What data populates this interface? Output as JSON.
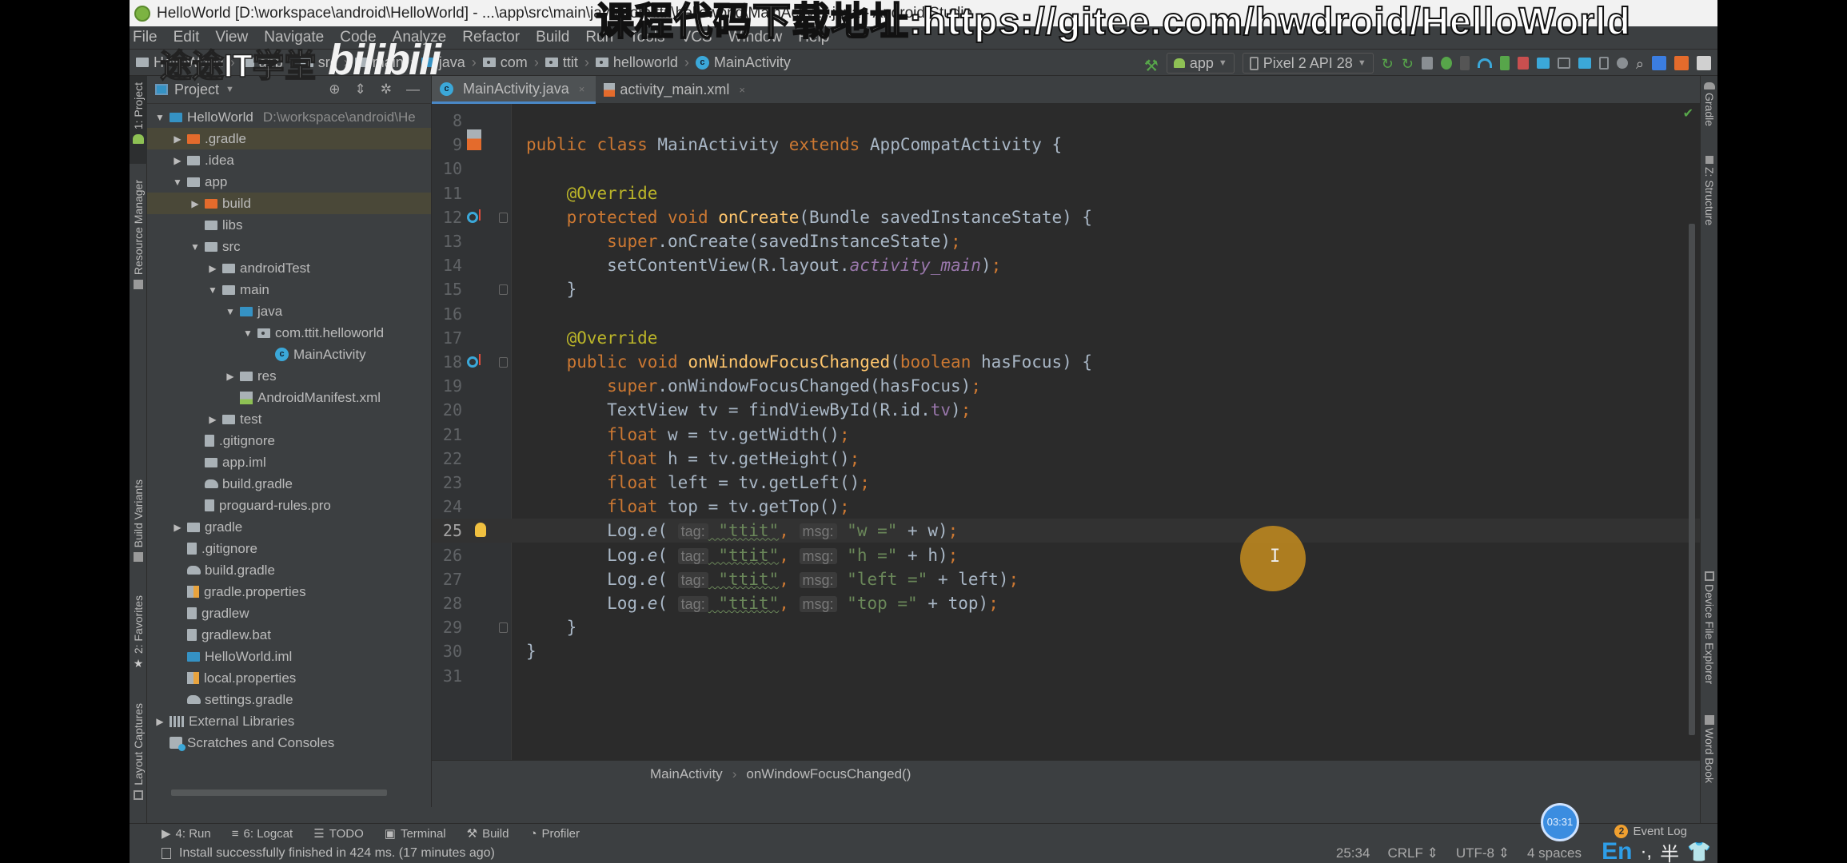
{
  "window": {
    "title": "HelloWorld [D:\\workspace\\android\\HelloWorld] - ...\\app\\src\\main\\java\\com\\ttit\\helloworld\\MainActivity.java - Android Studio"
  },
  "overlays": {
    "watermark_top": "课程代码下载地址:https://gitee.com/hwdroid/HelloWorld",
    "watermark_channel": "途途IT学堂",
    "watermark_site": "bilibili"
  },
  "menu": [
    "File",
    "Edit",
    "View",
    "Navigate",
    "Code",
    "Analyze",
    "Refactor",
    "Build",
    "Run",
    "Tools",
    "VCS",
    "Window",
    "Help"
  ],
  "navbar": {
    "crumbs": [
      {
        "label": "HelloWorld",
        "icon": "project-folder-icon"
      },
      {
        "label": "app",
        "icon": "module-folder-icon"
      },
      {
        "label": "src",
        "icon": "folder-icon"
      },
      {
        "label": "main",
        "icon": "folder-icon"
      },
      {
        "label": "java",
        "icon": "source-folder-icon"
      },
      {
        "label": "com",
        "icon": "package-icon"
      },
      {
        "label": "ttit",
        "icon": "package-icon"
      },
      {
        "label": "helloworld",
        "icon": "package-icon"
      },
      {
        "label": "MainActivity",
        "icon": "class-icon"
      }
    ],
    "run_config": "app",
    "device": "Pixel 2 API 28",
    "toolbar_icons": [
      "hammer-icon",
      "apply-changes-icon",
      "apply-code-changes-icon",
      "coverage-icon",
      "debug-icon",
      "attach-icon",
      "profile-icon",
      "debug-attach-icon",
      "stop-icon",
      "sync-icon",
      "avd-manager-icon",
      "sdk-manager-icon",
      "device-manager-icon",
      "layout-inspector-icon",
      "search-icon",
      "translate-icon",
      "plugin-icon",
      "account-icon"
    ]
  },
  "left_strip": {
    "tabs": [
      "1: Project",
      "Resource Manager",
      "Build Variants",
      "2: Favorites",
      "Layout Captures"
    ]
  },
  "right_strip": {
    "tabs": [
      "Gradle",
      "Z: Structure",
      "Device File Explorer",
      "Word Book"
    ]
  },
  "project_panel": {
    "title": "Project",
    "tree": [
      {
        "label": "HelloWorld",
        "path": "D:\\workspace\\android\\He",
        "depth": 0,
        "toggle": "open",
        "icon": "project"
      },
      {
        "label": ".gradle",
        "depth": 1,
        "toggle": "closed",
        "icon": "orange-folder",
        "highlight": true
      },
      {
        "label": ".idea",
        "depth": 1,
        "toggle": "closed",
        "icon": "folder"
      },
      {
        "label": "app",
        "depth": 1,
        "toggle": "open",
        "icon": "module"
      },
      {
        "label": "build",
        "depth": 2,
        "toggle": "closed",
        "icon": "orange-folder",
        "highlight": true
      },
      {
        "label": "libs",
        "depth": 2,
        "toggle": "none",
        "icon": "folder"
      },
      {
        "label": "src",
        "depth": 2,
        "toggle": "open",
        "icon": "folder"
      },
      {
        "label": "androidTest",
        "depth": 3,
        "toggle": "closed",
        "icon": "folder"
      },
      {
        "label": "main",
        "depth": 3,
        "toggle": "open",
        "icon": "folder"
      },
      {
        "label": "java",
        "depth": 4,
        "toggle": "open",
        "icon": "blue-folder"
      },
      {
        "label": "com.ttit.helloworld",
        "depth": 5,
        "toggle": "open",
        "icon": "package"
      },
      {
        "label": "MainActivity",
        "depth": 6,
        "toggle": "none",
        "icon": "class"
      },
      {
        "label": "res",
        "depth": 4,
        "toggle": "closed",
        "icon": "res-folder"
      },
      {
        "label": "AndroidManifest.xml",
        "depth": 4,
        "toggle": "none",
        "icon": "manifest"
      },
      {
        "label": "test",
        "depth": 3,
        "toggle": "closed",
        "icon": "folder"
      },
      {
        "label": ".gitignore",
        "depth": 2,
        "toggle": "none",
        "icon": "file"
      },
      {
        "label": "app.iml",
        "depth": 2,
        "toggle": "none",
        "icon": "module"
      },
      {
        "label": "build.gradle",
        "depth": 2,
        "toggle": "none",
        "icon": "gradle"
      },
      {
        "label": "proguard-rules.pro",
        "depth": 2,
        "toggle": "none",
        "icon": "file"
      },
      {
        "label": "gradle",
        "depth": 1,
        "toggle": "closed",
        "icon": "folder"
      },
      {
        "label": ".gitignore",
        "depth": 1,
        "toggle": "none",
        "icon": "file"
      },
      {
        "label": "build.gradle",
        "depth": 1,
        "toggle": "none",
        "icon": "gradle"
      },
      {
        "label": "gradle.properties",
        "depth": 1,
        "toggle": "none",
        "icon": "props"
      },
      {
        "label": "gradlew",
        "depth": 1,
        "toggle": "none",
        "icon": "file"
      },
      {
        "label": "gradlew.bat",
        "depth": 1,
        "toggle": "none",
        "icon": "file"
      },
      {
        "label": "HelloWorld.iml",
        "depth": 1,
        "toggle": "none",
        "icon": "project"
      },
      {
        "label": "local.properties",
        "depth": 1,
        "toggle": "none",
        "icon": "props"
      },
      {
        "label": "settings.gradle",
        "depth": 1,
        "toggle": "none",
        "icon": "gradle"
      },
      {
        "label": "External Libraries",
        "depth": 0,
        "toggle": "closed",
        "icon": "libs"
      },
      {
        "label": "Scratches and Consoles",
        "depth": 0,
        "toggle": "none",
        "icon": "scratch"
      }
    ]
  },
  "editor": {
    "tabs": [
      {
        "label": "MainActivity.java",
        "active": true,
        "icon": "class-icon"
      },
      {
        "label": "activity_main.xml",
        "active": false,
        "icon": "xml-icon"
      }
    ],
    "current_line": 25,
    "lines": [
      {
        "n": "8",
        "tokens": []
      },
      {
        "n": "9",
        "gutter": "xml",
        "tokens": [
          [
            "kw",
            "public "
          ],
          [
            "kw",
            "class "
          ],
          [
            "",
            "MainActivity "
          ],
          [
            "kw",
            "extends "
          ],
          [
            "",
            "AppCompatActivity {"
          ]
        ]
      },
      {
        "n": "10",
        "tokens": []
      },
      {
        "n": "11",
        "tokens": [
          [
            "",
            "    "
          ],
          [
            "ann",
            "@Override"
          ]
        ]
      },
      {
        "n": "12",
        "gutter": "override",
        "fold": true,
        "tokens": [
          [
            "",
            "    "
          ],
          [
            "kw",
            "protected "
          ],
          [
            "kw",
            "void "
          ],
          [
            "fn",
            "onCreate"
          ],
          [
            "",
            "(Bundle savedInstanceState) {"
          ]
        ]
      },
      {
        "n": "13",
        "tokens": [
          [
            "",
            "        "
          ],
          [
            "kw",
            "super"
          ],
          [
            "",
            ".onCreate(savedInstanceState)"
          ],
          [
            "punct",
            ";"
          ]
        ]
      },
      {
        "n": "14",
        "tokens": [
          [
            "",
            "        setContentView(R.layout."
          ],
          [
            "fld",
            "activity_main"
          ],
          [
            "",
            ")"
          ],
          [
            "punct",
            ";"
          ]
        ]
      },
      {
        "n": "15",
        "fold": true,
        "tokens": [
          [
            "",
            "    }"
          ]
        ]
      },
      {
        "n": "16",
        "tokens": []
      },
      {
        "n": "17",
        "tokens": [
          [
            "",
            "    "
          ],
          [
            "ann",
            "@Override"
          ]
        ]
      },
      {
        "n": "18",
        "gutter": "override",
        "fold": true,
        "tokens": [
          [
            "",
            "    "
          ],
          [
            "kw",
            "public "
          ],
          [
            "kw",
            "void "
          ],
          [
            "fn",
            "onWindowFocusChanged"
          ],
          [
            "",
            "("
          ],
          [
            "kw",
            "boolean "
          ],
          [
            "",
            "hasFocus) {"
          ]
        ]
      },
      {
        "n": "19",
        "tokens": [
          [
            "",
            "        "
          ],
          [
            "kw",
            "super"
          ],
          [
            "",
            ".onWindowFocusChanged(hasFocus)"
          ],
          [
            "punct",
            ";"
          ]
        ]
      },
      {
        "n": "20",
        "tokens": [
          [
            "",
            "        TextView tv = findViewById(R.id."
          ],
          [
            "fld2",
            "tv"
          ],
          [
            "",
            ")"
          ],
          [
            "punct",
            ";"
          ]
        ]
      },
      {
        "n": "21",
        "tokens": [
          [
            "",
            "        "
          ],
          [
            "kw",
            "float "
          ],
          [
            "",
            "w = tv.getWidth()"
          ],
          [
            "punct",
            ";"
          ]
        ]
      },
      {
        "n": "22",
        "tokens": [
          [
            "",
            "        "
          ],
          [
            "kw",
            "float "
          ],
          [
            "",
            "h = tv.getHeight()"
          ],
          [
            "punct",
            ";"
          ]
        ]
      },
      {
        "n": "23",
        "tokens": [
          [
            "",
            "        "
          ],
          [
            "kw",
            "float "
          ],
          [
            "",
            "left = tv.getLeft()"
          ],
          [
            "punct",
            ";"
          ]
        ]
      },
      {
        "n": "24",
        "tokens": [
          [
            "",
            "        "
          ],
          [
            "kw",
            "float "
          ],
          [
            "",
            "top = tv.getTop()"
          ],
          [
            "punct",
            ";"
          ]
        ]
      },
      {
        "n": "25",
        "gutter": "bulb",
        "tokens": [
          [
            "",
            "        Log."
          ],
          [
            "fnit",
            "e"
          ],
          [
            "",
            "( "
          ],
          [
            "hint",
            "tag:"
          ],
          [
            "str",
            " \"ttit\""
          ],
          [
            "punct",
            ", "
          ],
          [
            "hint",
            "msg:"
          ],
          [
            "str",
            " \"w =\""
          ],
          [
            "",
            " + w)"
          ],
          [
            "punct",
            ";"
          ]
        ]
      },
      {
        "n": "26",
        "tokens": [
          [
            "",
            "        Log."
          ],
          [
            "fnit",
            "e"
          ],
          [
            "",
            "( "
          ],
          [
            "hint",
            "tag:"
          ],
          [
            "str",
            " \"ttit\""
          ],
          [
            "punct",
            ", "
          ],
          [
            "hint",
            "msg:"
          ],
          [
            "str",
            " \"h =\""
          ],
          [
            "",
            " + h)"
          ],
          [
            "punct",
            ";"
          ]
        ]
      },
      {
        "n": "27",
        "tokens": [
          [
            "",
            "        Log."
          ],
          [
            "fnit",
            "e"
          ],
          [
            "",
            "( "
          ],
          [
            "hint",
            "tag:"
          ],
          [
            "str",
            " \"ttit\""
          ],
          [
            "punct",
            ", "
          ],
          [
            "hint",
            "msg:"
          ],
          [
            "str",
            " \"left =\""
          ],
          [
            "",
            " + left)"
          ],
          [
            "punct",
            ";"
          ]
        ]
      },
      {
        "n": "28",
        "tokens": [
          [
            "",
            "        Log."
          ],
          [
            "fnit",
            "e"
          ],
          [
            "",
            "( "
          ],
          [
            "hint",
            "tag:"
          ],
          [
            "str",
            " \"ttit\""
          ],
          [
            "punct",
            ", "
          ],
          [
            "hint",
            "msg:"
          ],
          [
            "str",
            " \"top =\""
          ],
          [
            "",
            " + top)"
          ],
          [
            "punct",
            ";"
          ]
        ]
      },
      {
        "n": "29",
        "fold": true,
        "tokens": [
          [
            "",
            "    }"
          ]
        ]
      },
      {
        "n": "30",
        "tokens": [
          [
            "",
            "}"
          ]
        ]
      },
      {
        "n": "31",
        "tokens": []
      }
    ],
    "breadcrumb": [
      "MainActivity",
      "onWindowFocusChanged()"
    ]
  },
  "tool_windows": [
    {
      "label": "4: Run",
      "icon": "run-icon"
    },
    {
      "label": "6: Logcat",
      "icon": "logcat-icon"
    },
    {
      "label": "TODO",
      "icon": "todo-icon"
    },
    {
      "label": "Terminal",
      "icon": "terminal-icon"
    },
    {
      "label": "Build",
      "icon": "build-icon"
    },
    {
      "label": "Profiler",
      "icon": "profiler-icon"
    }
  ],
  "event_log": {
    "label": "Event Log",
    "count": "2"
  },
  "status": {
    "message": "Install successfully finished in 424 ms. (17 minutes ago)",
    "position": "25:34",
    "line_sep": "CRLF",
    "encoding": "UTF-8",
    "indent": "4 spaces"
  },
  "recording_timer": "03:31",
  "ime": {
    "lang": "En",
    "punct": "·,",
    "width": "半"
  },
  "colors": {
    "keyword": "#cc7832",
    "annotation": "#bbb529",
    "method": "#ffc66d",
    "string": "#6a8759",
    "field": "#9876aa",
    "editor_bg": "#2b2b2b",
    "panel_bg": "#3c3f41"
  }
}
